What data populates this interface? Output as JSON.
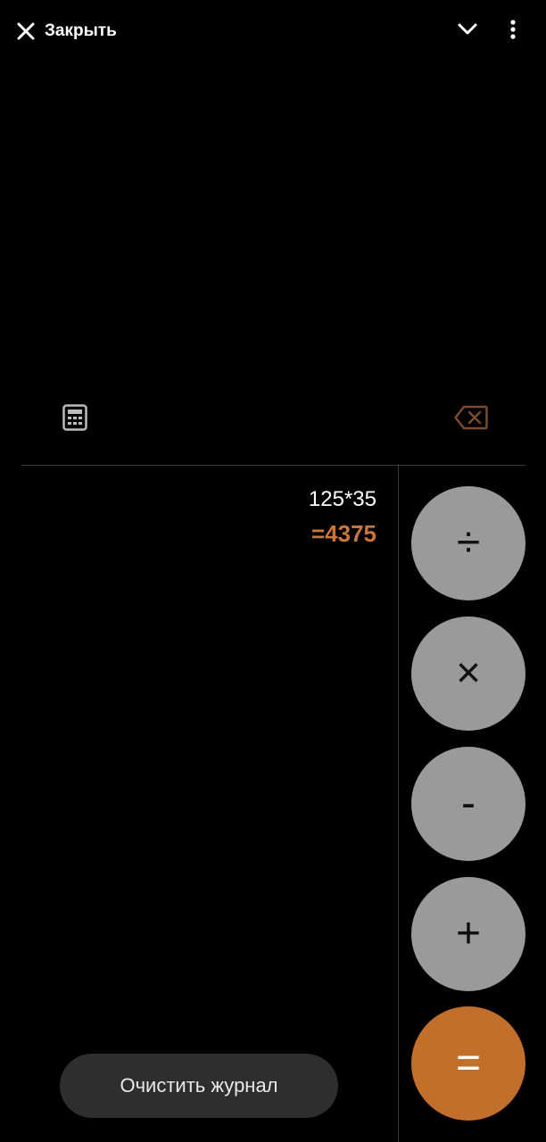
{
  "header": {
    "close_label": "Закрыть",
    "close_icon": "close-icon",
    "collapse_icon": "chevron-down-icon",
    "more_icon": "more-vertical-icon"
  },
  "toolbar": {
    "calculator_icon": "calculator-icon",
    "backspace_icon": "backspace-icon"
  },
  "history": {
    "expression": "125*35",
    "result": "=4375"
  },
  "operators": {
    "divide": "÷",
    "multiply": "×",
    "minus": "-",
    "plus": "+",
    "equals": "="
  },
  "footer": {
    "clear_history_label": "Очистить журнал"
  },
  "colors": {
    "background": "#000000",
    "operator_button": "#9a9a9a",
    "equals_button": "#c26f2b",
    "result_text": "#c8763a",
    "clear_button": "#2e2e2e"
  }
}
